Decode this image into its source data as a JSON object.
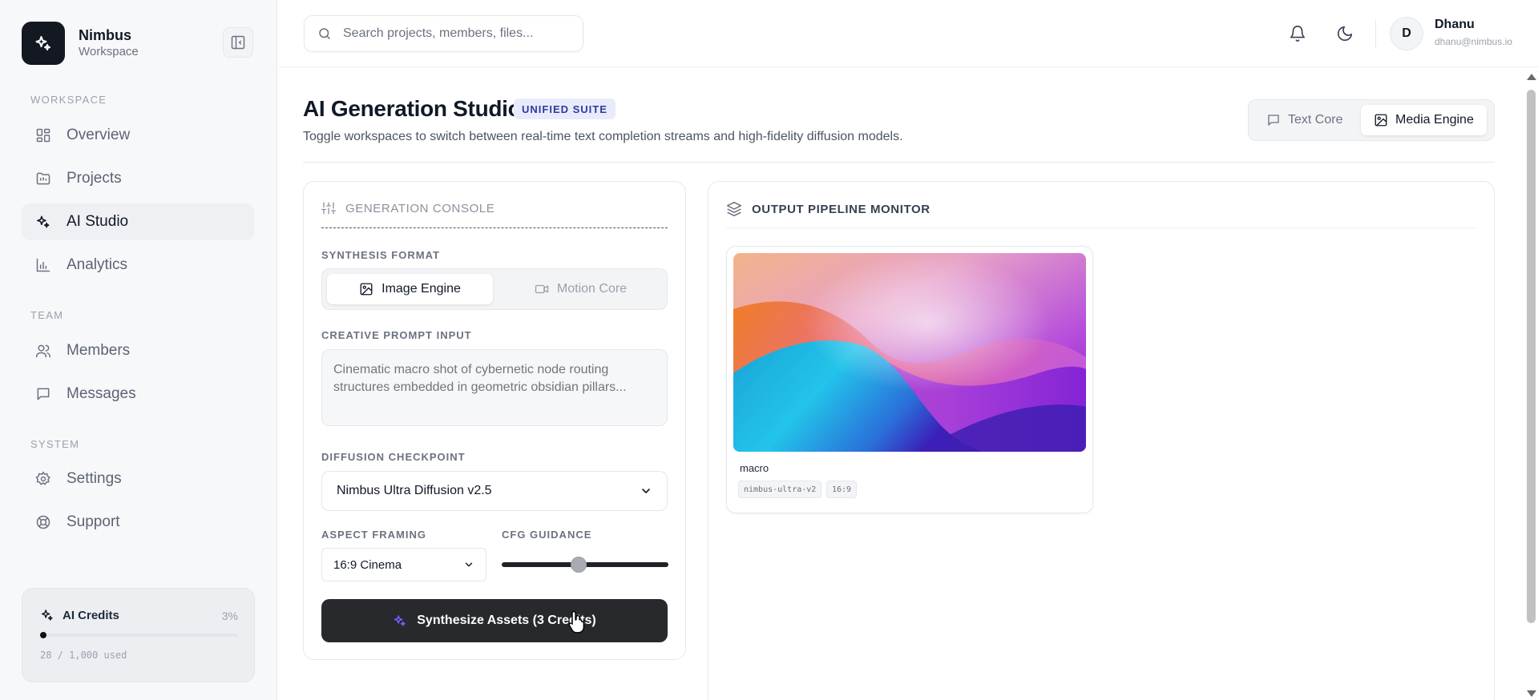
{
  "brand": {
    "name": "Nimbus",
    "sub": "Workspace"
  },
  "sidebar": {
    "sections": [
      "WORKSPACE",
      "TEAM",
      "SYSTEM"
    ],
    "items": [
      {
        "label": "Overview",
        "icon": "grid-icon"
      },
      {
        "label": "Projects",
        "icon": "folder-icon"
      },
      {
        "label": "AI Studio",
        "icon": "sparkles-icon",
        "active": true
      },
      {
        "label": "Analytics",
        "icon": "bar-chart-icon"
      },
      {
        "label": "Members",
        "icon": "users-icon"
      },
      {
        "label": "Messages",
        "icon": "message-icon"
      },
      {
        "label": "Settings",
        "icon": "gear-icon"
      },
      {
        "label": "Support",
        "icon": "lifebuoy-icon"
      }
    ],
    "credits": {
      "title": "AI Credits",
      "percent": "3%",
      "used_text": "28 / 1,000 used",
      "fraction": 0.028
    }
  },
  "topbar": {
    "search_placeholder": "Search projects, members, files...",
    "user": {
      "initial": "D",
      "name": "Dhanu",
      "email": "dhanu@nimbus.io"
    }
  },
  "page": {
    "title": "AI Generation Studio",
    "badge": "UNIFIED SUITE",
    "description": "Toggle workspaces to switch between real-time text completion streams and high-fidelity diffusion models.",
    "modes": [
      "Text Core",
      "Media Engine"
    ],
    "active_mode": "Media Engine"
  },
  "console": {
    "title": "GENERATION CONSOLE",
    "format_label": "SYNTHESIS FORMAT",
    "formats": [
      "Image Engine",
      "Motion Core"
    ],
    "prompt_label": "CREATIVE PROMPT INPUT",
    "prompt_placeholder": "Cinematic macro shot of cybernetic node routing structures embedded in geometric obsidian pillars...",
    "checkpoint_label": "DIFFUSION CHECKPOINT",
    "checkpoint_value": "Nimbus Ultra Diffusion v2.5",
    "aspect_label": "ASPECT FRAMING",
    "aspect_value": "16:9 Cinema",
    "cfg_label": "CFG GUIDANCE",
    "cfg_fraction": 0.46,
    "button_label": "Synthesize Assets (3 Credits)"
  },
  "monitor": {
    "title": "OUTPUT PIPELINE MONITOR",
    "assets": [
      {
        "name": "macro",
        "tags": [
          "nimbus-ultra-v2",
          "16:9"
        ]
      }
    ]
  },
  "colors": {
    "primary_dark": "#27292d",
    "accent_badge_bg": "#e8ebfb",
    "accent_badge_text": "#2e3a9f",
    "sparkle_accent": "#6d63ff"
  }
}
